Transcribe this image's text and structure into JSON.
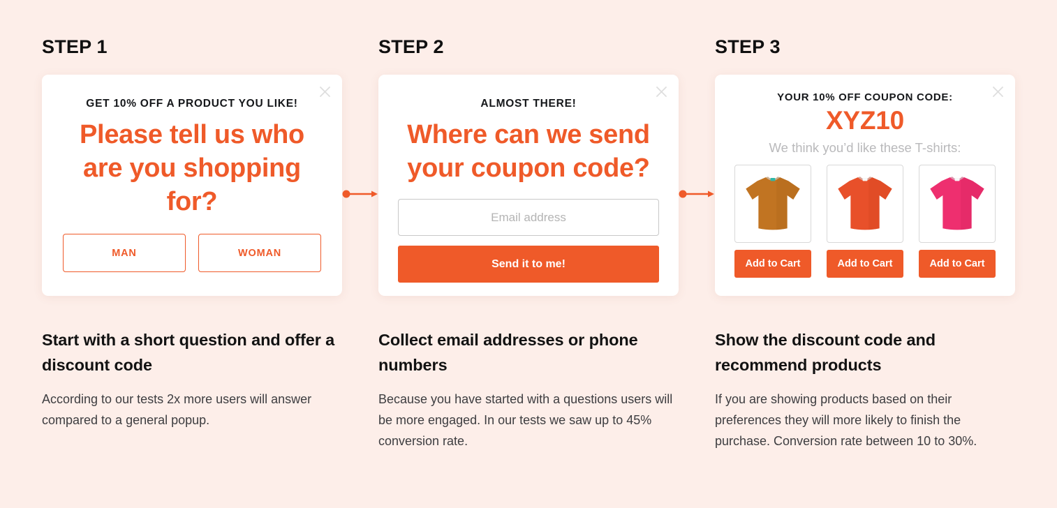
{
  "theme": {
    "background": "#fdeee9",
    "accent": "#ef5a29",
    "card_background": "#ffffff",
    "muted_text": "#b9b9bb",
    "heading_text": "#121212"
  },
  "steps": [
    {
      "label": "STEP 1",
      "popup": {
        "close_icon": "close-icon",
        "eyebrow": "GET 10% OFF A PRODUCT YOU LIKE!",
        "headline": "Please tell us who are you shopping for?",
        "choices": [
          "MAN",
          "WOMAN"
        ]
      },
      "title": "Start with a short question and offer a discount code",
      "body": "According to our tests 2x more users will answer compared to a general popup."
    },
    {
      "label": "STEP 2",
      "popup": {
        "close_icon": "close-icon",
        "eyebrow": "ALMOST THERE!",
        "headline": "Where can we send your coupon code?",
        "email_placeholder": "Email address",
        "email_value": "",
        "submit_label": "Send it to me!"
      },
      "title": "Collect email addresses or phone numbers",
      "body": "Because you have started with a questions users will be more engaged. In our tests we saw up to 45% conversion rate."
    },
    {
      "label": "STEP 3",
      "popup": {
        "close_icon": "close-icon",
        "eyebrow": "YOUR 10% OFF COUPON CODE:",
        "coupon_code": "XYZ10",
        "recommend_text": "We think you’d like these T-shirts:",
        "products": [
          {
            "name": "t-shirt-ochre",
            "color": "#c17422",
            "shade": "#a55f15",
            "add_label": "Add to Cart"
          },
          {
            "name": "t-shirt-orange",
            "color": "#e8502a",
            "shade": "#c93e1d",
            "add_label": "Add to Cart"
          },
          {
            "name": "t-shirt-pink",
            "color": "#ee2f6f",
            "shade": "#cf1f58",
            "add_label": "Add to Cart"
          }
        ]
      },
      "title": "Show the discount code and recommend products",
      "body": "If you are showing products based on their preferences they will more likely to finish the purchase. Conversion rate between 10 to 30%."
    }
  ],
  "connectors": [
    {
      "name": "connector-arrow-1"
    },
    {
      "name": "connector-arrow-2"
    }
  ]
}
